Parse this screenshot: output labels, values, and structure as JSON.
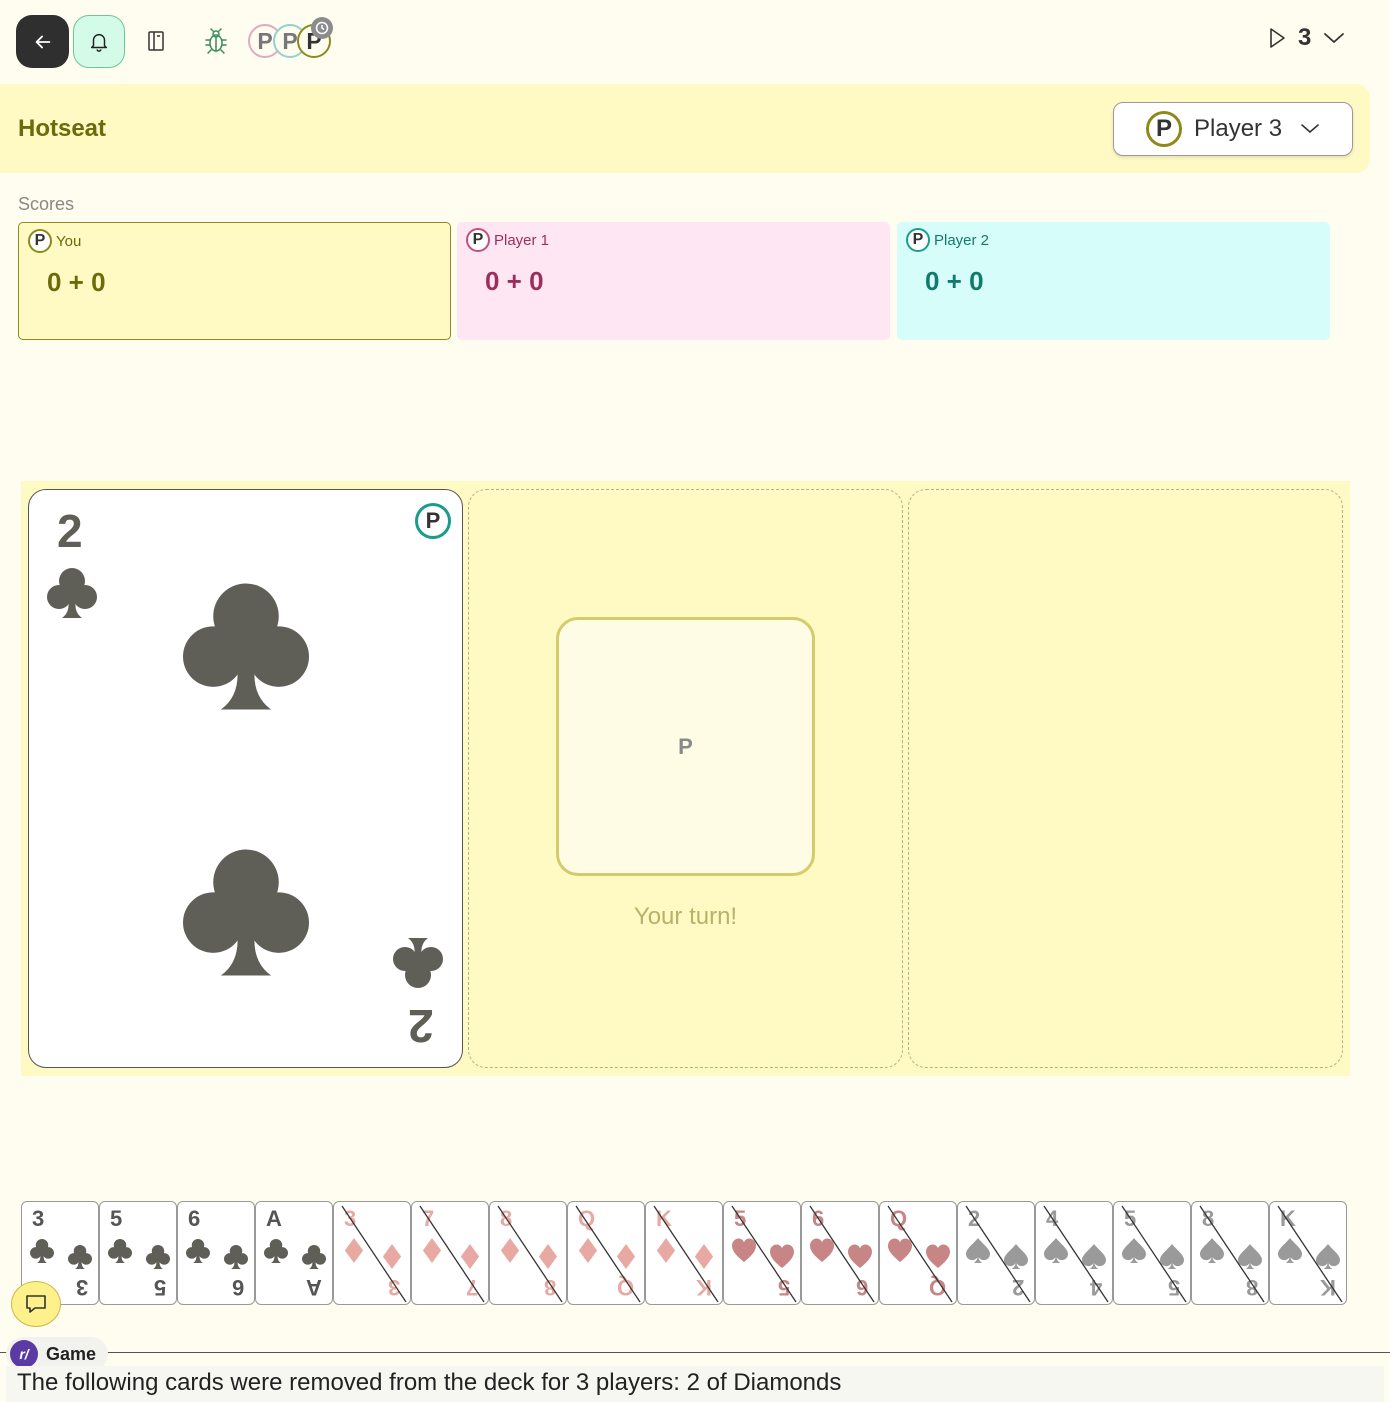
{
  "topbar": {
    "avatars": [
      {
        "letter": "P",
        "color": "#e5a9bd"
      },
      {
        "letter": "P",
        "color": "#8fd3cf"
      },
      {
        "letter": "P",
        "color": "#8e8a1a"
      }
    ],
    "round": "3"
  },
  "header": {
    "title": "Hotseat",
    "current_player": {
      "avatar": "P",
      "name": "Player 3"
    }
  },
  "scores": {
    "label": "Scores",
    "players": [
      {
        "avatar": "P",
        "name": "You",
        "score": "0 + 0",
        "bg": "#fffac4",
        "border": "#8e8a1a",
        "text": "#6b6b0a"
      },
      {
        "avatar": "P",
        "name": "Player 1",
        "score": "0 + 0",
        "bg": "#ffe6f3",
        "border": "#c05080",
        "text": "#9c2e5e"
      },
      {
        "avatar": "P",
        "name": "Player 2",
        "score": "0 + 0",
        "bg": "#d6fdfa",
        "border": "#1a9c8c",
        "text": "#127a6d"
      }
    ]
  },
  "table": {
    "played_card": {
      "rank": "2",
      "suit": "clubs",
      "owner_avatar": "P"
    },
    "turn_box_letter": "P",
    "turn_text": "Your turn!"
  },
  "hand": [
    {
      "rank": "3",
      "suit": "clubs",
      "playable": true
    },
    {
      "rank": "5",
      "suit": "clubs",
      "playable": true
    },
    {
      "rank": "6",
      "suit": "clubs",
      "playable": true
    },
    {
      "rank": "A",
      "suit": "clubs",
      "playable": true
    },
    {
      "rank": "3",
      "suit": "diamonds",
      "playable": false
    },
    {
      "rank": "7",
      "suit": "diamonds",
      "playable": false
    },
    {
      "rank": "8",
      "suit": "diamonds",
      "playable": false
    },
    {
      "rank": "Q",
      "suit": "diamonds",
      "playable": false
    },
    {
      "rank": "K",
      "suit": "diamonds",
      "playable": false
    },
    {
      "rank": "5",
      "suit": "hearts",
      "playable": false
    },
    {
      "rank": "6",
      "suit": "hearts",
      "playable": false
    },
    {
      "rank": "Q",
      "suit": "hearts",
      "playable": false
    },
    {
      "rank": "2",
      "suit": "spades",
      "playable": false
    },
    {
      "rank": "4",
      "suit": "spades",
      "playable": false
    },
    {
      "rank": "5",
      "suit": "spades",
      "playable": false
    },
    {
      "rank": "8",
      "suit": "spades",
      "playable": false
    },
    {
      "rank": "K",
      "suit": "spades",
      "playable": false
    }
  ],
  "log": {
    "source": "Game",
    "avatar": "r/",
    "message": "The following cards were removed from the deck for 3 players: 2 of Diamonds"
  },
  "colors": {
    "clubs": "#5f5f57",
    "diamonds": "#e9a9a3",
    "hearts": "#c88585",
    "spades": "#9a9a9a"
  }
}
